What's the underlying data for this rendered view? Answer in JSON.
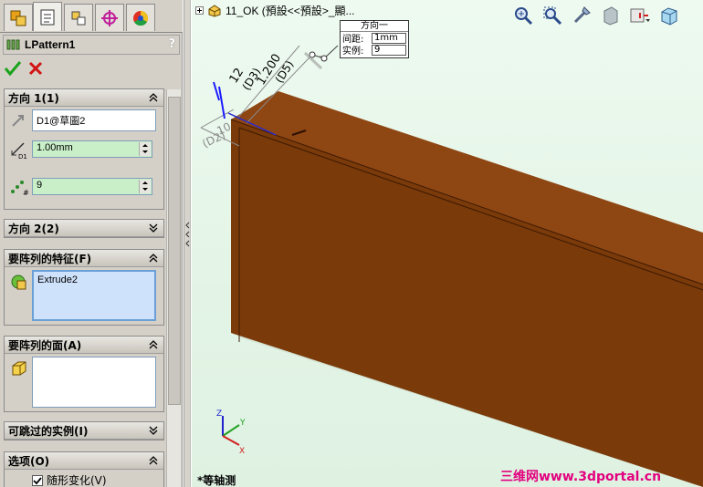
{
  "panel": {
    "tabs": [
      {
        "name": "feature-manager-tab",
        "icon": "feature-tree-icon"
      },
      {
        "name": "property-manager-tab",
        "icon": "property-manager-icon"
      },
      {
        "name": "configuration-manager-tab",
        "icon": "configuration-icon"
      },
      {
        "name": "dimxpert-tab",
        "icon": "crosshair-icon"
      },
      {
        "name": "display-manager-tab",
        "icon": "color-wheel-icon"
      }
    ],
    "title": "LPattern1",
    "help": "?",
    "direction1": {
      "title": "方向 1(1)",
      "direction_ref": "D1@草圖2",
      "spacing": "1.00mm",
      "instances": "9"
    },
    "direction2": {
      "title": "方向 2(2)"
    },
    "features": {
      "title": "要阵列的特征(F)",
      "items": [
        "Extrude2"
      ]
    },
    "faces": {
      "title": "要阵列的面(A)"
    },
    "skip": {
      "title": "可跳过的实例(I)"
    },
    "options": {
      "title": "选项(O)",
      "vary_sketch_label": "随形变化(V)",
      "vary_sketch_checked": true
    }
  },
  "graphics": {
    "tree_label": "11_OK  (預設<<預設>_顯...",
    "callout": {
      "title": "方向一",
      "spacing_label": "间距:",
      "spacing_value": "1mm",
      "instances_label": "实例:",
      "instances_value": "9"
    },
    "dimensions": [
      "12",
      "1.200",
      "(D3)",
      "(D5)",
      "(D2)",
      "10"
    ],
    "view_name": "*等轴测",
    "triad": [
      "X",
      "Y",
      "Z"
    ],
    "watermark": "三维网www.3dportal.cn",
    "colors": {
      "beam": "#7a3a0a",
      "beam_top": "#8e4613",
      "background": "#e6f6e9",
      "dimension": "#1a1aa0"
    }
  }
}
